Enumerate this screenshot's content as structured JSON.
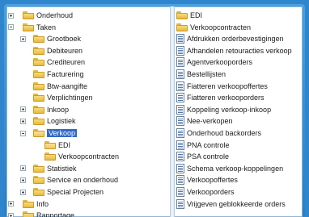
{
  "tree": {
    "items": [
      {
        "label": "Onderhoud",
        "level": 0,
        "expander": "plus",
        "icon": "folder-icon"
      },
      {
        "label": "Taken",
        "level": 0,
        "expander": "minus",
        "icon": "folder-icon"
      },
      {
        "label": "Grootboek",
        "level": 1,
        "expander": "plus",
        "icon": "folder-icon"
      },
      {
        "label": "Debiteuren",
        "level": 1,
        "expander": "none",
        "icon": "folder-icon"
      },
      {
        "label": "Crediteuren",
        "level": 1,
        "expander": "none",
        "icon": "folder-icon"
      },
      {
        "label": "Facturering",
        "level": 1,
        "expander": "none",
        "icon": "folder-icon"
      },
      {
        "label": "Btw-aangifte",
        "level": 1,
        "expander": "none",
        "icon": "folder-icon"
      },
      {
        "label": "Verplichtingen",
        "level": 1,
        "expander": "none",
        "icon": "folder-icon"
      },
      {
        "label": "Inkoop",
        "level": 1,
        "expander": "plus",
        "icon": "folder-icon"
      },
      {
        "label": "Logistiek",
        "level": 1,
        "expander": "plus",
        "icon": "folder-icon"
      },
      {
        "label": "Verkoop",
        "level": 1,
        "expander": "minus",
        "icon": "open-folder-icon",
        "selected": true
      },
      {
        "label": "EDI",
        "level": 2,
        "expander": "none",
        "icon": "open-folder-icon"
      },
      {
        "label": "Verkoopcontracten",
        "level": 2,
        "expander": "none",
        "icon": "folder-icon"
      },
      {
        "label": "Statistiek",
        "level": 1,
        "expander": "plus",
        "icon": "folder-icon"
      },
      {
        "label": "Service en onderhoud",
        "level": 1,
        "expander": "plus",
        "icon": "folder-icon"
      },
      {
        "label": "Special Projecten",
        "level": 1,
        "expander": "plus",
        "icon": "folder-icon"
      },
      {
        "label": "Info",
        "level": 0,
        "expander": "plus",
        "icon": "folder-icon"
      },
      {
        "label": "Rapportage",
        "level": 0,
        "expander": "plus",
        "icon": "folder-icon"
      }
    ]
  },
  "list": {
    "items": [
      {
        "label": "EDI",
        "icon": "folder-icon"
      },
      {
        "label": "Verkoopcontracten",
        "icon": "folder-icon"
      },
      {
        "label": "Afdrukken orderbevestigingen",
        "icon": "printer-icon"
      },
      {
        "label": "Afhandelen retouracties verkoop",
        "icon": "document-icon"
      },
      {
        "label": "Agentverkooporders",
        "icon": "document-icon"
      },
      {
        "label": "Bestellijsten",
        "icon": "document-icon"
      },
      {
        "label": "Fiatteren verkoopoffertes",
        "icon": "document-icon"
      },
      {
        "label": "Fiatteren verkooporders",
        "icon": "document-icon"
      },
      {
        "label": "Koppeling verkoop-inkoop",
        "icon": "document-icon"
      },
      {
        "label": "Nee-verkopen",
        "icon": "document-icon"
      },
      {
        "label": "Onderhoud backorders",
        "icon": "document-icon"
      },
      {
        "label": "PNA controle",
        "icon": "document-icon"
      },
      {
        "label": "PSA controle",
        "icon": "document-icon"
      },
      {
        "label": "Schema verkoop-koppelingen",
        "icon": "document-icon"
      },
      {
        "label": "Verkoopoffertes",
        "icon": "document-icon"
      },
      {
        "label": "Verkooporders",
        "icon": "document-icon"
      },
      {
        "label": "Vrijgeven geblokkeerde orders",
        "icon": "document-icon"
      }
    ]
  },
  "colors": {
    "frame": "#2f86cc",
    "selection": "#316ac5",
    "folder": "#f0c652"
  }
}
